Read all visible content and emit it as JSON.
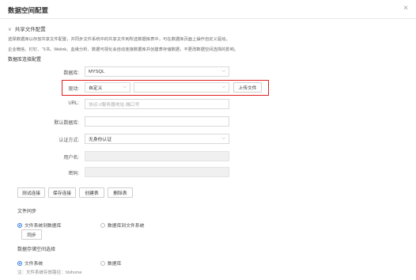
{
  "header": {
    "title": "数据空间配置"
  },
  "section": {
    "title": "共享文件配置"
  },
  "descriptions": [
    "选择数据库以存放共享文件配置，并同步文件系统中的共享文件到所选数据库表中，可在数据库页面上操作自定义驱动。",
    "企业微信、钉钉、飞书、Welink、血缘分析、数据可视化会自动连接数据库并创建表存储数据，不更改数据空间选择的影响。"
  ],
  "db_config": {
    "title": "数据库连接配置",
    "database_label": "数据库:",
    "database_value": "MYSQL",
    "driver_label": "驱动:",
    "driver_value": "自定义",
    "driver_file_value": "",
    "upload_label": "上传文件",
    "url_label": "URL:",
    "url_placeholder": "协议://服务器地址:端口号",
    "default_db_label": "默认数据库:",
    "auth_label": "认证方式:",
    "auth_value": "无身份认证",
    "username_label": "用户名:",
    "password_label": "密码:"
  },
  "actions": {
    "test": "测试连接",
    "save": "保存连接",
    "create": "创建表",
    "delete": "删除表"
  },
  "file_sync": {
    "title": "文件同步",
    "option1": "文件系统到数据库",
    "option2": "数据库到文件系统",
    "sync_button": "同步"
  },
  "storage": {
    "title": "数据存储空间选择",
    "option1": "文件系统",
    "option2": "数据库",
    "note": "注：文件系统存放路径：\\\\bihome"
  },
  "colors": {
    "accent": "#2a7ae2",
    "highlight": "#e02020"
  }
}
